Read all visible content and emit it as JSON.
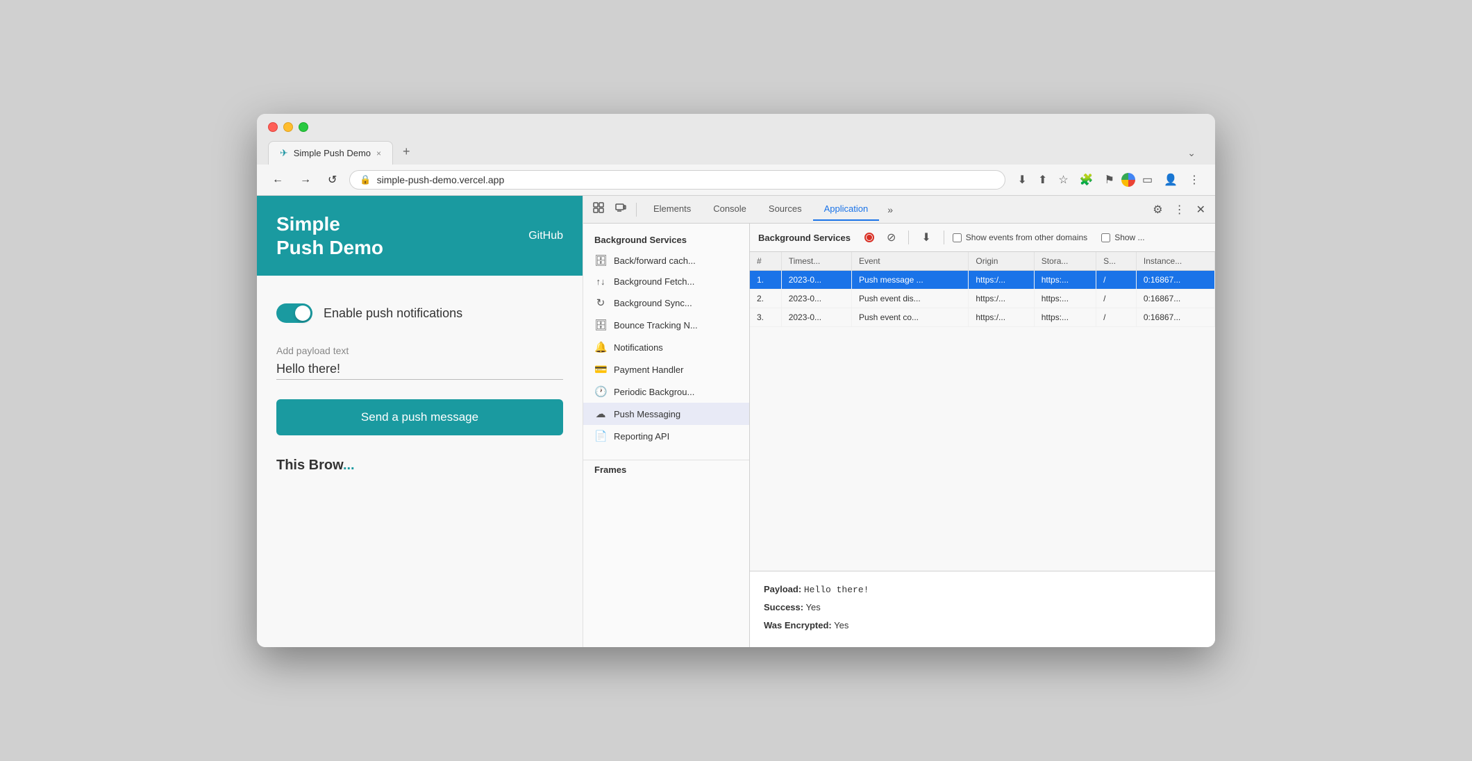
{
  "browser": {
    "tab_title": "Simple Push Demo",
    "tab_close": "×",
    "tab_new": "+",
    "tab_chevron": "⌄",
    "address": "simple-push-demo.vercel.app",
    "nav": {
      "back": "←",
      "forward": "→",
      "reload": "↺",
      "lock": "🔒",
      "download": "⬇",
      "share": "⬆",
      "star": "☆",
      "extensions": "🧩",
      "flag": "⚑",
      "profile": "👤",
      "more": "⋮"
    }
  },
  "website": {
    "title_line1": "Simple",
    "title_line2": "Push Demo",
    "github_link": "GitHub",
    "toggle_label": "Enable push notifications",
    "payload_label": "Add payload text",
    "payload_value": "Hello there!",
    "send_button": "Send a push message",
    "this_browser": "This Browser"
  },
  "devtools": {
    "tabs": [
      "Elements",
      "Console",
      "Sources",
      "Application"
    ],
    "active_tab": "Application",
    "more_tabs": "»",
    "settings_icon": "⚙",
    "more_options": "⋮",
    "close_icon": "×",
    "inspect_icon": "⬚",
    "responsive_icon": "▭",
    "sidebar_title": "Background Services",
    "sidebar_items": [
      {
        "icon": "🗄",
        "label": "Back/forward cach..."
      },
      {
        "icon": "↑↓",
        "label": "Background Fetch..."
      },
      {
        "icon": "↻",
        "label": "Background Sync..."
      },
      {
        "icon": "🗄",
        "label": "Bounce Tracking N..."
      },
      {
        "icon": "🔔",
        "label": "Notifications"
      },
      {
        "icon": "💳",
        "label": "Payment Handler"
      },
      {
        "icon": "🕐",
        "label": "Periodic Backgrou..."
      },
      {
        "icon": "☁",
        "label": "Push Messaging"
      },
      {
        "icon": "📄",
        "label": "Reporting API"
      }
    ],
    "frames_title": "Frames",
    "bg_services_label": "Background Services",
    "record_title": "Record",
    "clear_title": "Clear",
    "download_title": "Download",
    "show_other_domains": "Show events from other domains",
    "show_more": "Show ...",
    "table_headers": [
      "#",
      "Timest...",
      "Event",
      "Origin",
      "Stora...",
      "S...",
      "Instance..."
    ],
    "table_rows": [
      {
        "num": "1.",
        "timestamp": "2023-0...",
        "event": "Push message ...",
        "origin": "https:/...",
        "storage": "https:...",
        "s": "/",
        "instance": "0:16867..."
      },
      {
        "num": "2.",
        "timestamp": "2023-0...",
        "event": "Push event dis...",
        "origin": "https:/...",
        "storage": "https:...",
        "s": "/",
        "instance": "0:16867..."
      },
      {
        "num": "3.",
        "timestamp": "2023-0...",
        "event": "Push event co...",
        "origin": "https:/...",
        "storage": "https:...",
        "s": "/",
        "instance": "0:16867..."
      }
    ],
    "detail": {
      "payload_key": "Payload:",
      "payload_val": "Hello there!",
      "success_key": "Success:",
      "success_val": "Yes",
      "encrypted_key": "Was Encrypted:",
      "encrypted_val": "Yes"
    }
  }
}
